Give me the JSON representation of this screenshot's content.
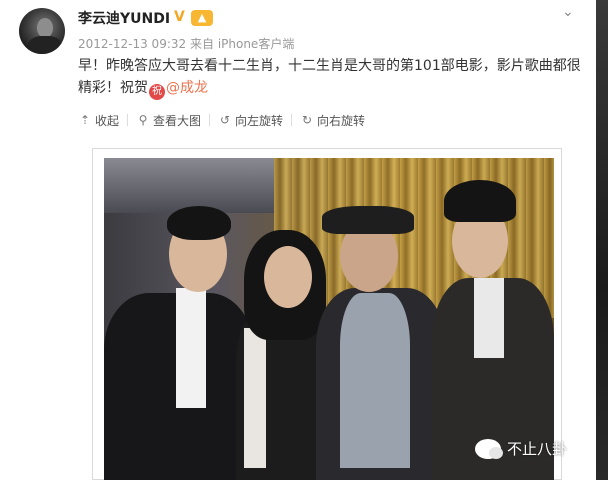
{
  "user": {
    "name": "李云迪YUNDI",
    "verified_mark": "V",
    "badge": "▲"
  },
  "post": {
    "timestamp": "2012-12-13 09:32",
    "source_prefix": "来自",
    "source": "iPhone客户端",
    "text_before": "早！昨晚答应大哥去看十二生肖，十二生肖是大哥的第101部电影，影片歌曲都很精彩！祝贺",
    "zhu_icon": "祝",
    "mention": "@成龙"
  },
  "toolbar": {
    "collapse": "收起",
    "view_large": "查看大图",
    "rotate_left": "向左旋转",
    "rotate_right": "向右旋转"
  },
  "watermark": {
    "text": "不止八卦"
  },
  "icons": {
    "collapse": "arrow-up-icon",
    "view_large": "magnifier-icon",
    "rotate_left": "rotate-left-icon",
    "rotate_right": "rotate-right-icon",
    "more": "chevron-down-icon"
  },
  "colors": {
    "mention": "#eb7350",
    "meta": "#999999",
    "verified": "#f5a623"
  }
}
